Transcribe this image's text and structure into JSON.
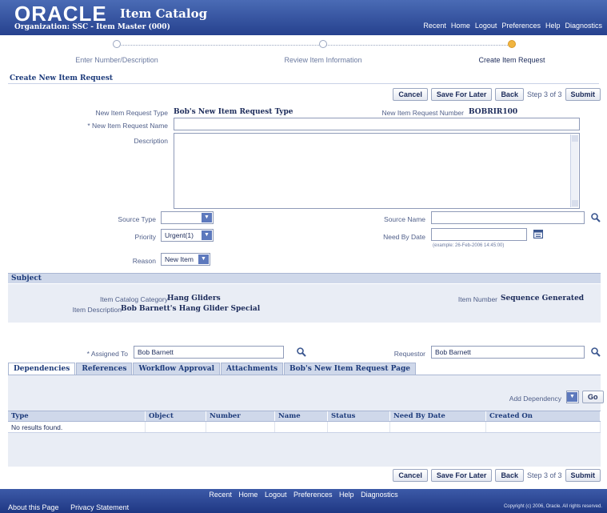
{
  "header": {
    "logo": "ORACLE",
    "app_title": "Item Catalog",
    "organization": "Organization: SSC - Item Master (000)",
    "links": [
      "Recent",
      "Home",
      "Logout",
      "Preferences",
      "Help",
      "Diagnostics"
    ]
  },
  "train": {
    "steps": [
      "Enter Number/Description",
      "Review Item Information",
      "Create Item Request"
    ],
    "active_step": 3
  },
  "page_title": "Create New Item Request",
  "buttons": {
    "cancel": "Cancel",
    "save_for_later": "Save For Later",
    "back": "Back",
    "step_text": "Step 3 of 3",
    "submit": "Submit"
  },
  "form": {
    "request_type_label": "New Item Request Type",
    "request_type_value": "Bob's New Item Request Type",
    "request_number_label": "New Item Request Number",
    "request_number_value": "BOBRIR100",
    "request_name_label": "* New Item Request Name",
    "request_name_value": "",
    "description_label": "Description",
    "source_type_label": "Source Type",
    "source_type_value": "",
    "source_name_label": "Source Name",
    "source_name_value": "",
    "priority_label": "Priority",
    "priority_value": "Urgent(1)",
    "need_by_date_label": "Need By Date",
    "need_by_date_value": "",
    "need_by_date_hint": "(example: 26-Feb-2006 14:45:00)",
    "reason_label": "Reason",
    "reason_value": "New Item"
  },
  "subject": {
    "heading": "Subject",
    "category_label": "Item Catalog Category",
    "category_value": "Hang Gliders",
    "description_label": "Item Description",
    "description_value": "Bob Barnett's Hang Glider Special",
    "item_number_label": "Item Number",
    "item_number_value": "Sequence Generated"
  },
  "assignment": {
    "assigned_to_label": "* Assigned To",
    "assigned_to_value": "Bob Barnett",
    "requestor_label": "Requestor",
    "requestor_value": "Bob Barnett"
  },
  "tabs": [
    "Dependencies",
    "References",
    "Workflow Approval",
    "Attachments",
    "Bob's New Item Request Page"
  ],
  "dependencies": {
    "add_label": "Add Dependency",
    "go": "Go",
    "columns": [
      "Type",
      "Object",
      "Number",
      "Name",
      "Status",
      "Need By Date",
      "Created On"
    ],
    "empty_text": "No results found."
  },
  "footer": {
    "links": [
      "Recent",
      "Home",
      "Logout",
      "Preferences",
      "Help",
      "Diagnostics"
    ],
    "left_links": [
      "About this Page",
      "Privacy Statement"
    ],
    "copyright": "Copyright (c) 2006, Oracle. All rights reserved."
  },
  "colors": {
    "header_blue": "#26418e",
    "band_blue": "#cfd8ea",
    "active_step": "#f1b540"
  }
}
